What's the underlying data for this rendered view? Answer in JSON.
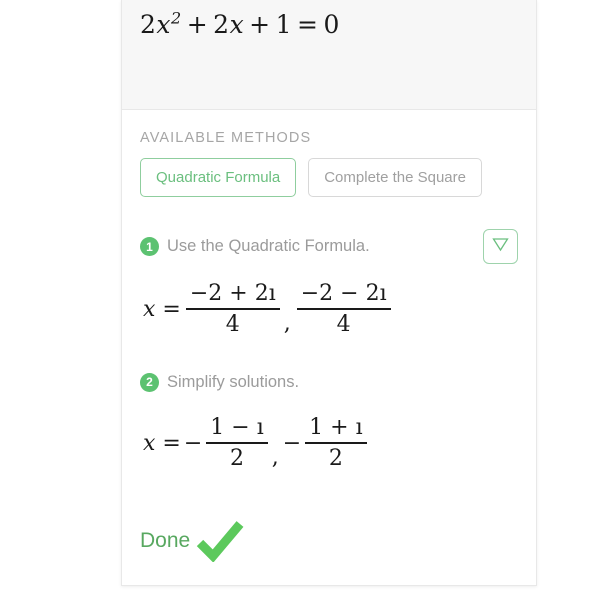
{
  "equation": {
    "coefficient_a": "2",
    "variable": "x",
    "exponent": "2",
    "plus_1": "+",
    "coefficient_b": "2",
    "variable_b": "x",
    "plus_2": "+",
    "constant_c": "1",
    "equals": "=",
    "rhs": "0",
    "full_text": "2x^2 + 2x + 1 = 0"
  },
  "methods": {
    "label": "AVAILABLE METHODS",
    "options": [
      {
        "label": "Quadratic Formula",
        "selected": true
      },
      {
        "label": "Complete the Square",
        "selected": false
      }
    ]
  },
  "steps": [
    {
      "number": "1",
      "text": "Use the Quadratic Formula.",
      "toggle_icon": "chevron-down-icon",
      "result": {
        "lead": "x =",
        "terms": [
          {
            "sign": "",
            "numerator": "−2 + 2ı",
            "denominator": "4"
          },
          {
            "sign": "",
            "numerator": "−2 − 2ı",
            "denominator": "4"
          }
        ],
        "separator": ","
      }
    },
    {
      "number": "2",
      "text": "Simplify solutions.",
      "result": {
        "lead": "x =",
        "terms": [
          {
            "sign": "−",
            "numerator": "1 − ı",
            "denominator": "2"
          },
          {
            "sign": "−",
            "numerator": "1 + ı",
            "denominator": "2"
          }
        ],
        "separator": ","
      }
    }
  ],
  "footer": {
    "done_label": "Done",
    "check_icon": "check-mark-icon"
  },
  "colors": {
    "accent_green": "#5cc271",
    "selected_border": "#8fce9e",
    "selected_text": "#6bbf7f",
    "muted_text": "#9b9b9b",
    "label_text": "#a6a6a6",
    "unselected_border": "#d8d8d8",
    "unselected_text": "#a0a0a0",
    "header_bg": "#f7f7f7",
    "done_text": "#58a860",
    "check_green": "#5cc95c"
  }
}
